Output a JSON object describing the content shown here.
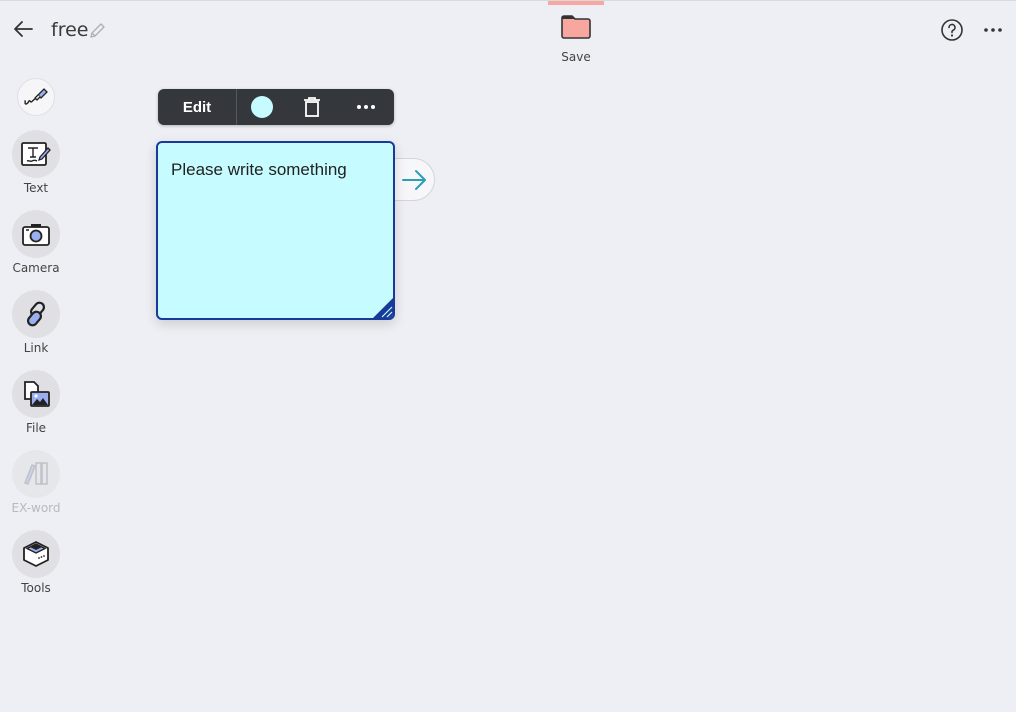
{
  "header": {
    "title": "free",
    "back_icon": "arrow-left-icon",
    "edit_title_icon": "pencil-icon",
    "save_label": "Save",
    "save_icon": "folder-icon",
    "help_icon": "help-circle-icon",
    "more_icon": "more-horizontal-icon"
  },
  "tools": [
    {
      "label": "",
      "icon": "pen-icon"
    },
    {
      "label": "Text",
      "icon": "text-icon"
    },
    {
      "label": "Camera",
      "icon": "camera-icon"
    },
    {
      "label": "Link",
      "icon": "link-icon"
    },
    {
      "label": "File",
      "icon": "file-image-icon"
    },
    {
      "label": "EX-word",
      "icon": "books-icon",
      "disabled": true
    },
    {
      "label": "Tools",
      "icon": "toolbox-icon"
    }
  ],
  "note_toolbar": {
    "edit_label": "Edit",
    "color_swatch": "#c6fcff",
    "trash_icon": "trash-icon",
    "more_icon": "more-horizontal-icon"
  },
  "note": {
    "text": "Please write something",
    "background": "#c6fcff",
    "border": "#1a3a9a",
    "next_icon": "arrow-right-icon"
  },
  "colors": {
    "background": "#eeeff4",
    "save_accent": "#f7a79f",
    "toolbar_dark": "#34373c",
    "arrow_teal": "#2a9fb8"
  }
}
